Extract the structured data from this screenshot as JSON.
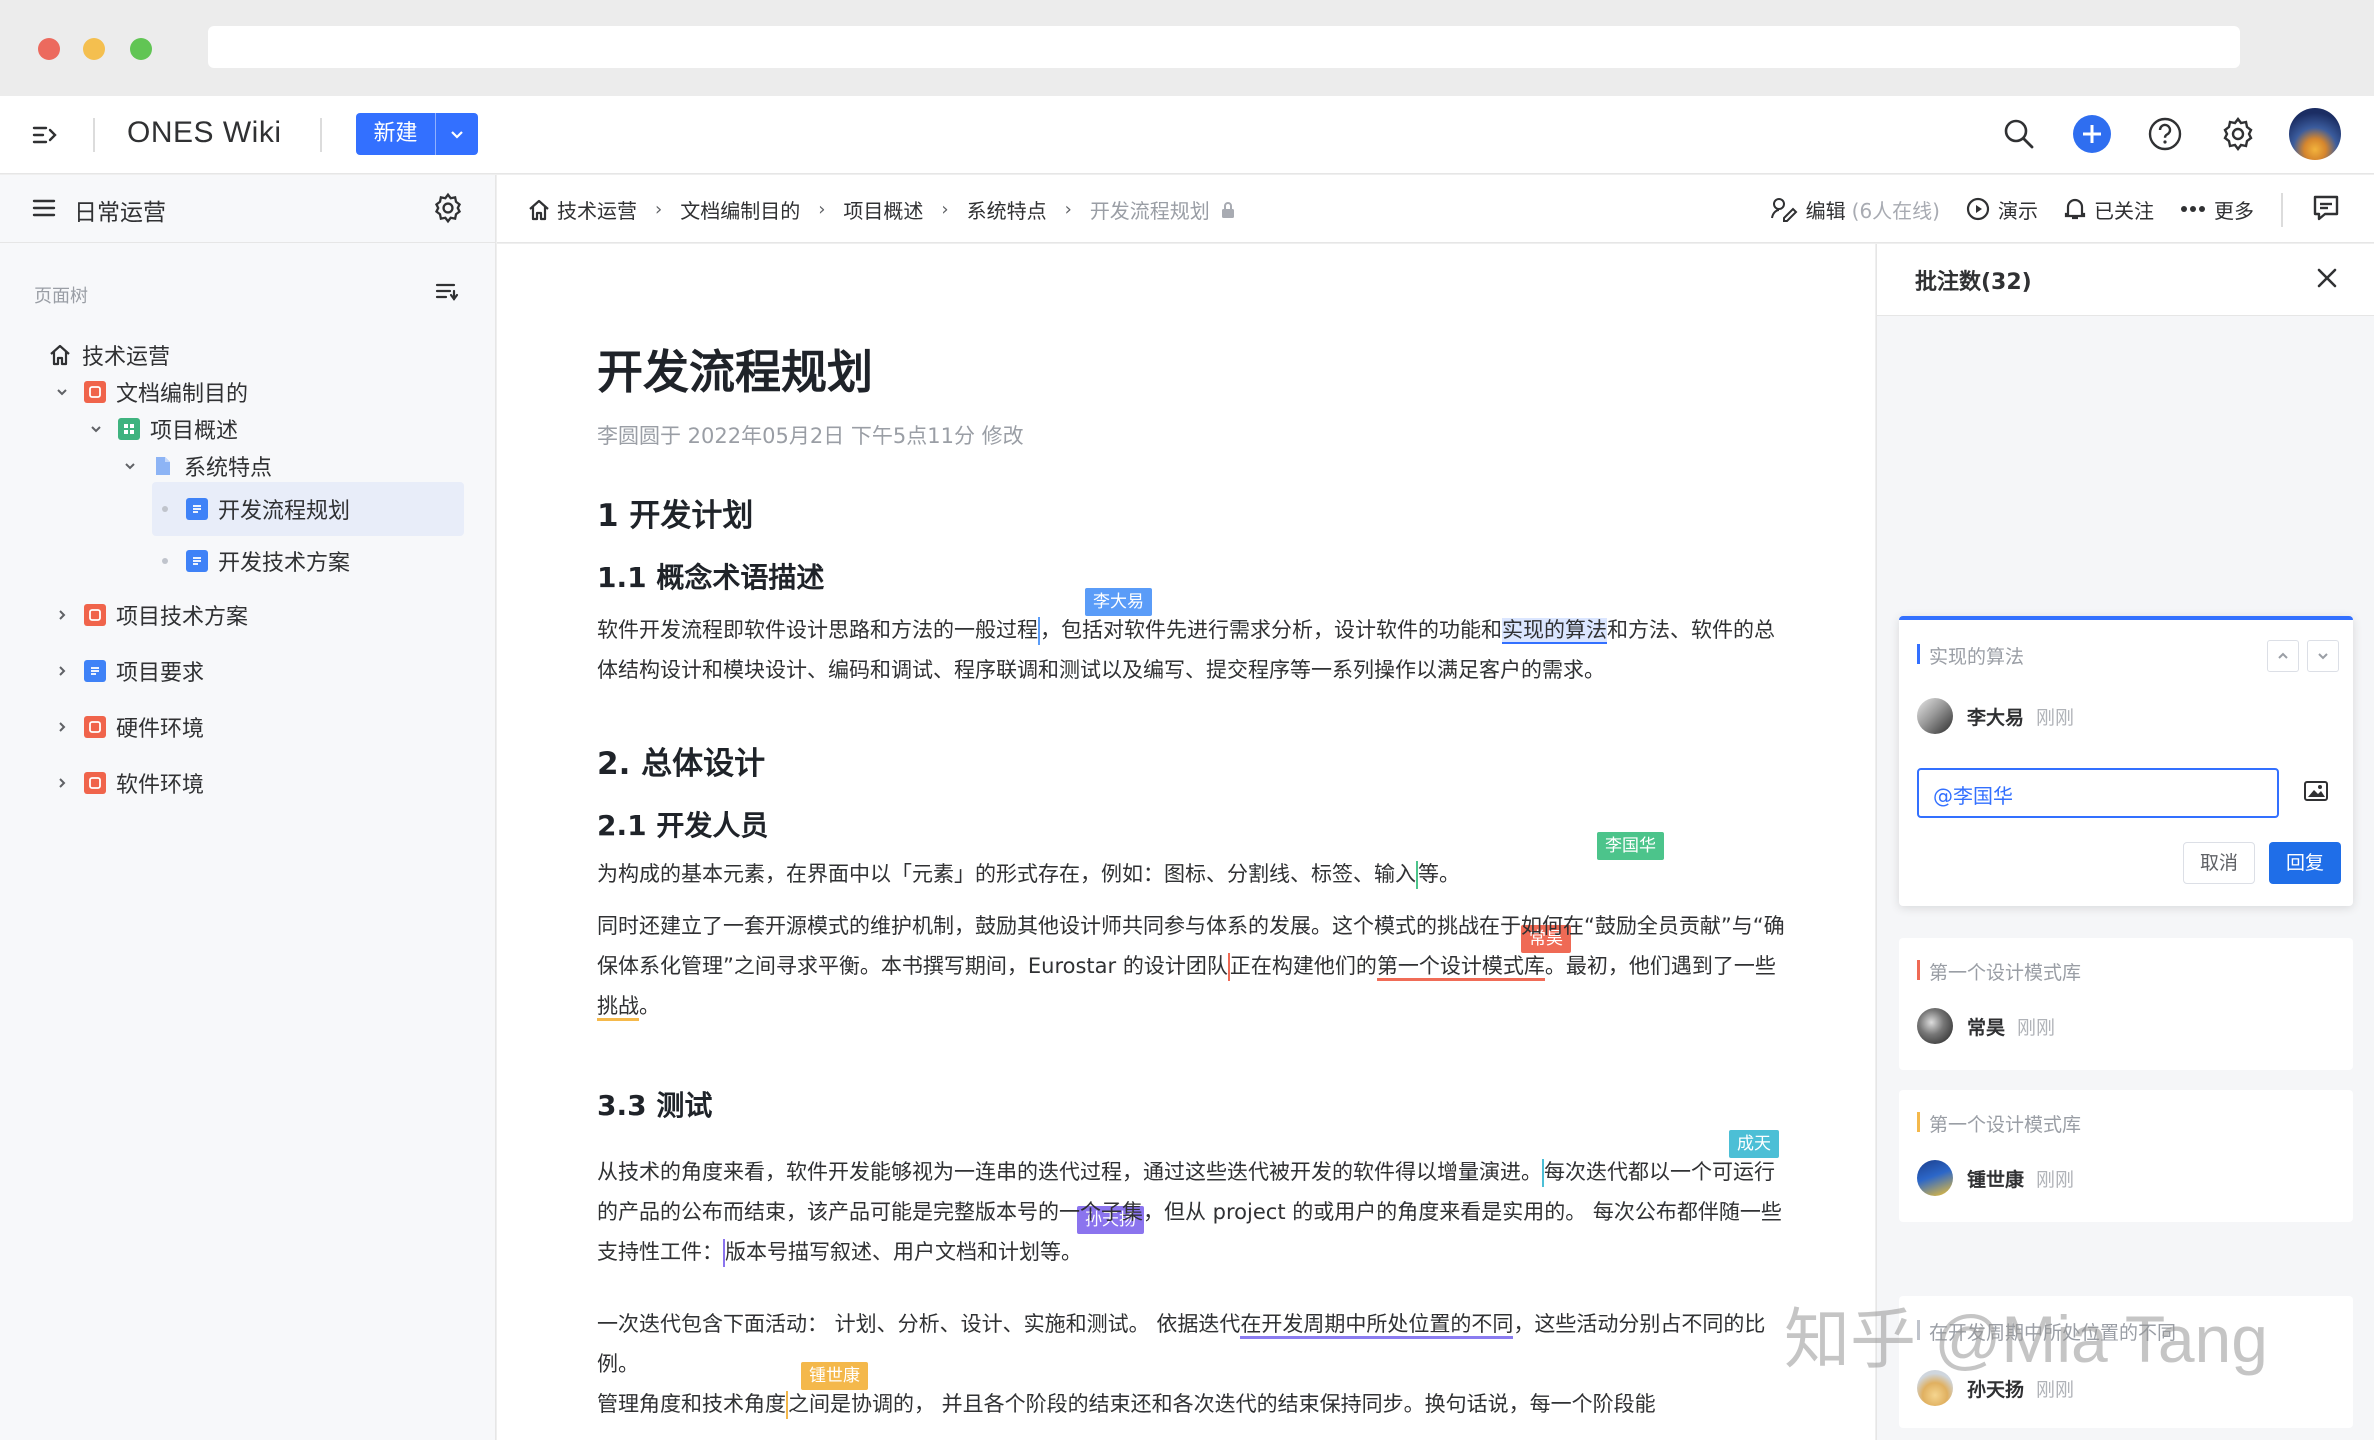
{
  "app": {
    "title": "ONES Wiki",
    "new_label": "新建"
  },
  "sidebar": {
    "space_name": "日常运营",
    "tree_label": "页面树",
    "items": [
      {
        "label": "技术运营"
      },
      {
        "label": "文档编制目的"
      },
      {
        "label": "项目概述"
      },
      {
        "label": "系统特点"
      },
      {
        "label": "开发流程规划"
      },
      {
        "label": "开发技术方案"
      },
      {
        "label": "项目技术方案"
      },
      {
        "label": "项目要求"
      },
      {
        "label": "硬件环境"
      },
      {
        "label": "软件环境"
      }
    ]
  },
  "breadcrumb": {
    "items": [
      "技术运营",
      "文档编制目的",
      "项目概述",
      "系统特点"
    ],
    "current": "开发流程规划"
  },
  "actions": {
    "edit": "编辑",
    "online": "(6人在线)",
    "present": "演示",
    "followed": "已关注",
    "more": "更多"
  },
  "doc": {
    "title": "开发流程规划",
    "meta": "李圆圆于 2022年05月2日 下午5点11分 修改",
    "h1": "1 开发计划",
    "h1_1": "1.1 概念术语描述",
    "p1_a": "软件开发流程即软件设计思路和方法的一般过程",
    "p1_b": "，包括对软件先进行需求分析，设计软件的功能和",
    "p1_c": "实现的算法",
    "p1_d": "和方法、软件的总体结构设计和模块设计、编码和调试、程序联调和测试以及编写、提交程序等一系列操作以满足客户的需求。",
    "h2": "2. 总体设计",
    "h2_1": "2.1 开发人员",
    "p2_a": "为构成的基本元素，在界面中以「元素」的形式存在，例如：图标、分割线、标签、输入",
    "p2_b": "等。",
    "p3_a": "同时还建立了一套开源模式的维护机制，鼓励其他设计师共同参与体系的发展。这个模式的挑战在于如何在“鼓励全员贡献”与“确保体系化管理”之间寻求平衡。本书撰写期间，Eurostar 的设计团队",
    "p3_b": "正在构建他们的",
    "p3_c": "第一个设计模式",
    "p3_d": "库",
    "p3_e": "。最初，他们遇到了一些",
    "p3_f": "挑战",
    "p3_g": "。",
    "h3_3": "3.3 测试",
    "p4_a": "从技术的角度来看，软件开发能够视为一连串的迭代过程，通过这些迭代被开发的软件得以增量演进。",
    "p4_b": "每次迭代都以一个可运行的产品的公布而结束，",
    "p4_c": "该产品可能是完整版本号的一个子集，但从 project 的或用户的角度来看是实用的。 每次公布都伴随一些支持性工件：",
    "p4_d": "版本号描写叙述、用户文档和计划等。",
    "p5_a": "一次迭代包含下面活动：  计划、分析、设计、实施和测试。 依据迭代",
    "p5_b": "在开发周期中所处位置的不同",
    "p5_c": "，这些活动分别占不同的比例。",
    "p6_a": "管理角度和技术角度",
    "p6_b": "之间是协调的，  并且各个阶段的结束还和各次迭代的结束保持同步。换句话说，每一个阶段能",
    "tags": {
      "t1": "李大易",
      "t2": "李国华",
      "t3": "常昊",
      "t4": "成天",
      "t5": "孙天扬",
      "t6": "锺世康"
    }
  },
  "comments": {
    "title": "批注数(32)",
    "active": {
      "quote": "实现的算法",
      "user": "李大易",
      "time": "刚刚",
      "input_value": "@李国华",
      "cancel": "取消",
      "reply": "回复"
    },
    "list": [
      {
        "quote": "第一个设计模式库",
        "user": "常昊",
        "time": "刚刚"
      },
      {
        "quote": "第一个设计模式库",
        "user": "锺世康",
        "time": "刚刚"
      },
      {
        "quote": "在开发周期中所处位置的不同",
        "user": "孙天扬",
        "time": "刚刚"
      }
    ]
  },
  "watermark": "知乎 @Mia Tang"
}
